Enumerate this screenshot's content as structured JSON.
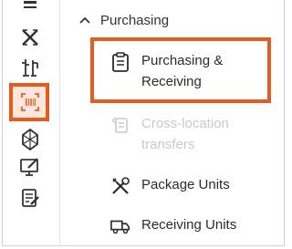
{
  "sidebar": {
    "icons": [
      {
        "name": "top-partial-icon"
      },
      {
        "name": "x-close-icon"
      },
      {
        "name": "stand-tool-icon"
      },
      {
        "name": "barcode-scan-icon",
        "active": true
      },
      {
        "name": "gem-cube-icon"
      },
      {
        "name": "monitor-edit-icon"
      },
      {
        "name": "clipboard-edit-icon"
      }
    ]
  },
  "panel": {
    "section_title": "Purchasing",
    "items": [
      {
        "label": "Purchasing &\nReceiving",
        "icon": "clipboard-icon",
        "highlighted": true,
        "disabled": false
      },
      {
        "label": "Cross-location\ntransfers",
        "icon": "transfer-icon",
        "highlighted": false,
        "disabled": true
      },
      {
        "label": "Package Units",
        "icon": "tools-icon",
        "highlighted": false,
        "disabled": false
      },
      {
        "label": "Receiving Units",
        "icon": "truck-icon",
        "highlighted": false,
        "disabled": false
      }
    ]
  },
  "colors": {
    "accent": "#e65c1f",
    "active_bg": "#fde7dd",
    "text": "#2b2b2b",
    "disabled_text": "#c9c9c9"
  }
}
